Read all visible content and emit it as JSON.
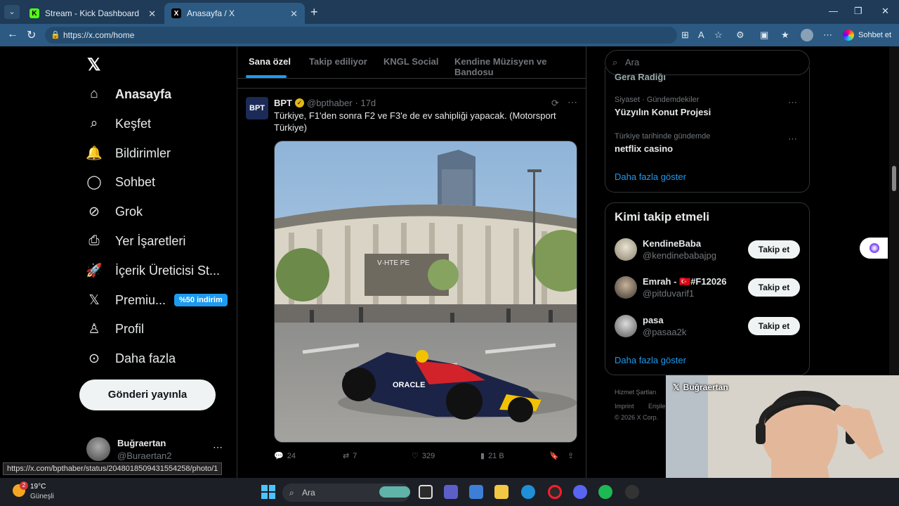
{
  "browser": {
    "tabs": [
      {
        "title": "Stream - Kick Dashboard",
        "favicon": "K"
      },
      {
        "title": "Anasayfa / X",
        "favicon": "X"
      }
    ],
    "url": "https://x.com/home",
    "sidebar_button_label": "Sohbet et",
    "status_url": "https://x.com/bpthaber/status/2048018509431554258/photo/1"
  },
  "nav": {
    "items": [
      {
        "label": "Anasayfa",
        "icon": "home-icon"
      },
      {
        "label": "Keşfet",
        "icon": "search-icon"
      },
      {
        "label": "Bildirimler",
        "icon": "bell-icon"
      },
      {
        "label": "Sohbet",
        "icon": "chat-icon"
      },
      {
        "label": "Grok",
        "icon": "grok-icon"
      },
      {
        "label": "Yer İşaretleri",
        "icon": "bookmark-icon"
      },
      {
        "label": "İçerik Üreticisi St...",
        "icon": "rocket-icon"
      },
      {
        "label": "Premiu...",
        "icon": "x-icon"
      },
      {
        "label": "Profil",
        "icon": "person-icon"
      },
      {
        "label": "Daha fazla",
        "icon": "more-circle-icon"
      }
    ],
    "premium_badge": "%50 indirim",
    "post_button": "Gönderi yayınla",
    "account": {
      "name": "Buğraertan",
      "handle": "@Buraertan2"
    }
  },
  "feed": {
    "tabs": [
      "Sana özel",
      "Takip ediliyor",
      "KNGL Social",
      "Kendine Müzisyen ve Bandosu"
    ],
    "post": {
      "avatar_text": "BPT",
      "author": "BPT",
      "handle": "@bpthaber",
      "time": "· 17d",
      "text": "Türkiye, F1'den sonra F2 ve F3'e de ev sahipliği yapacak. (Motorsport Türkiye)",
      "stats": {
        "replies": "24",
        "reposts": "7",
        "likes": "329",
        "views": "21 B"
      }
    }
  },
  "right": {
    "search_placeholder": "Ara",
    "partial_trend": "Gera Radiğı",
    "trends": [
      {
        "category": "Siyaset · Gündemdekiler",
        "name": "Yüzyılın Konut Projesi"
      },
      {
        "category": "Türkiye tarihinde gündemde",
        "name": "netflix casino"
      }
    ],
    "show_more": "Daha fazla göster",
    "who_to_follow_title": "Kimi takip etmeli",
    "follow": [
      {
        "name": "KendineBaba",
        "handle": "@kendinebabajpg"
      },
      {
        "name": "Emrah - 🇹🇷#F12026",
        "handle": "@pitduvarif1"
      },
      {
        "name": "pasa",
        "handle": "@pasaa2k"
      }
    ],
    "follow_button": "Takip et",
    "footer": [
      "Hizmet Şartları",
      "Imprint",
      "Erişile",
      "© 2026 X Corp."
    ]
  },
  "webcam": {
    "overlay_name": "Buğraertan"
  },
  "taskbar": {
    "weather": {
      "temp": "19°C",
      "desc": "Güneşli",
      "badge": "2"
    },
    "search_placeholder": "Ara"
  }
}
